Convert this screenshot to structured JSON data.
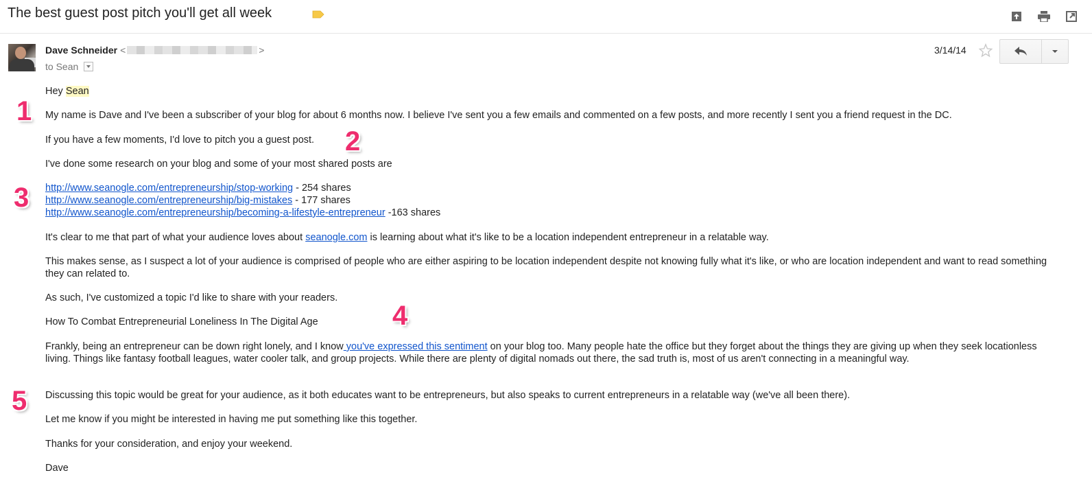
{
  "subject": "The best guest post pitch you'll get all week",
  "label_color": "#f7c948",
  "toolbar": {
    "icons": [
      "archive-icon",
      "print-icon",
      "new-window-icon"
    ]
  },
  "sender": {
    "name": "Dave Schneider",
    "email_open": "<",
    "email_close": ">",
    "to": "to Sean"
  },
  "date": "3/14/14",
  "body": {
    "greeting_prefix": "Hey ",
    "greeting_name": "Sean",
    "p1": "My name is Dave and I've been a subscriber of your blog for about 6 months now. I believe I've sent you a few emails and commented on a few posts, and more recently I sent you a friend request in the DC.",
    "p2": "If you have a few moments, I'd love to pitch you a guest post.",
    "p3": "I've done some research on your blog and some of your most shared posts are",
    "links": [
      {
        "url": "http://www.seanogle.com/entrepreneurship/stop-working",
        "suffix": " - 254 shares"
      },
      {
        "url": "http://www.seanogle.com/entrepreneurship/big-mistakes",
        "suffix": " - 177 shares"
      },
      {
        "url": "http://www.seanogle.com/entrepreneurship/becoming-a-lifestyle-entrepreneur",
        "suffix": " -163 shares"
      }
    ],
    "p4_before": "It's clear to me that part of what your audience loves about ",
    "p4_link": "seanogle.com",
    "p4_after": " is learning about what it's like to be a location independent entrepreneur in a relatable way.",
    "p5": "This makes sense, as I suspect a lot of your audience is comprised of people who are either aspiring to be location independent despite not knowing fully what it's like, or who are location independent and want to read something they can related to.",
    "p6": "As such, I've customized a topic I'd like to share with your readers.",
    "p7": "How To Combat Entrepreneurial Loneliness In The Digital Age",
    "p8_before": "Frankly, being an entrepreneur can be down right lonely, and I know",
    "p8_link": " you've expressed this sentiment",
    "p8_after": " on your blog too. Many people hate the office but they forget about the things they are giving up when they seek locationless living. Things like fantasy football leagues, water cooler talk, and group projects. While there are plenty of digital nomads out there, the sad truth is, most of us aren't connecting in a meaningful way.",
    "p9": "Discussing this topic would be great for your audience, as it both educates want to be entrepreneurs, but also speaks to current entrepreneurs in a relatable way (we've all been there).",
    "p10": "Let me know if you might be interested in having me put something like this together.",
    "p11": "Thanks for your consideration, and enjoy your weekend.",
    "signoff": "Dave"
  },
  "annotations": [
    "1",
    "2",
    "3",
    "4",
    "5"
  ],
  "annotation_color": "#ee2d6e"
}
